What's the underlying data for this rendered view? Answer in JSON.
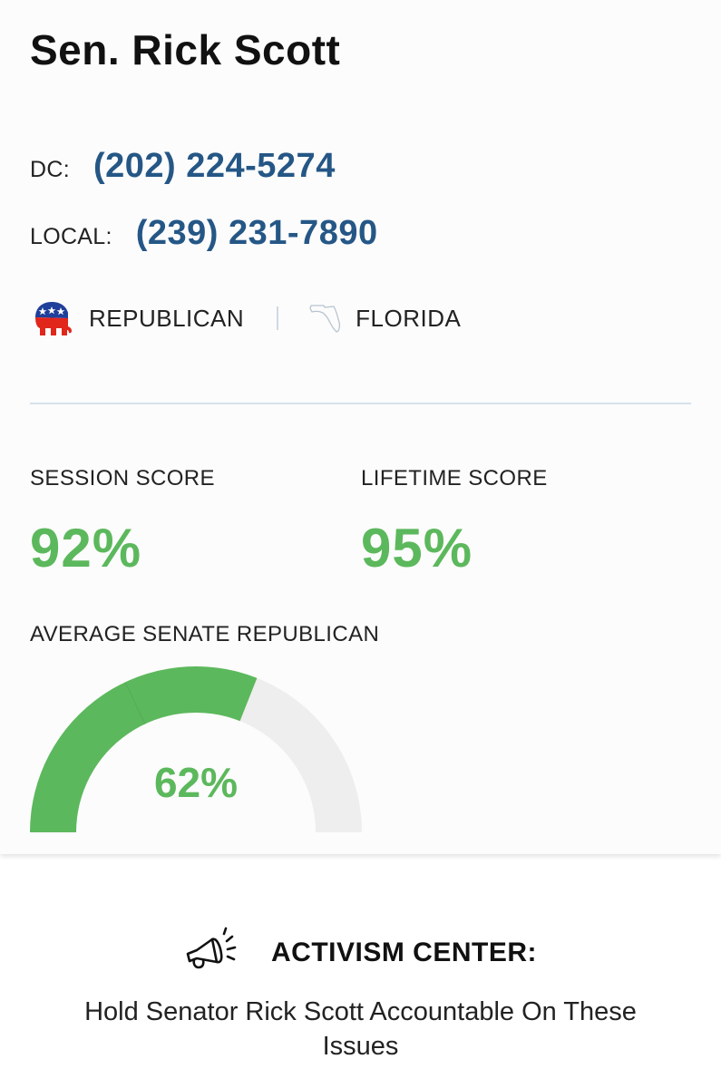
{
  "profile": {
    "name": "Sen. Rick Scott",
    "dc_label": "DC:",
    "dc_phone": "(202) 224-5274",
    "local_label": "LOCAL:",
    "local_phone": "(239) 231-7890",
    "party": "REPUBLICAN",
    "party_icon": "republican-elephant-icon",
    "state": "FLORIDA",
    "state_icon": "florida-outline-icon"
  },
  "scores": {
    "session_label": "SESSION SCORE",
    "session_value": "92%",
    "lifetime_label": "LIFETIME SCORE",
    "lifetime_value": "95%",
    "average_label": "AVERAGE SENATE REPUBLICAN",
    "average_value": "62%",
    "average_fraction": 0.62
  },
  "activism": {
    "icon": "megaphone-icon",
    "title": "ACTIVISM CENTER:",
    "description": "Hold Senator Rick Scott Accountable On These Issues"
  },
  "colors": {
    "accent_green": "#5cb85c",
    "phone_blue": "#255786",
    "gauge_track": "#eeeeee"
  }
}
